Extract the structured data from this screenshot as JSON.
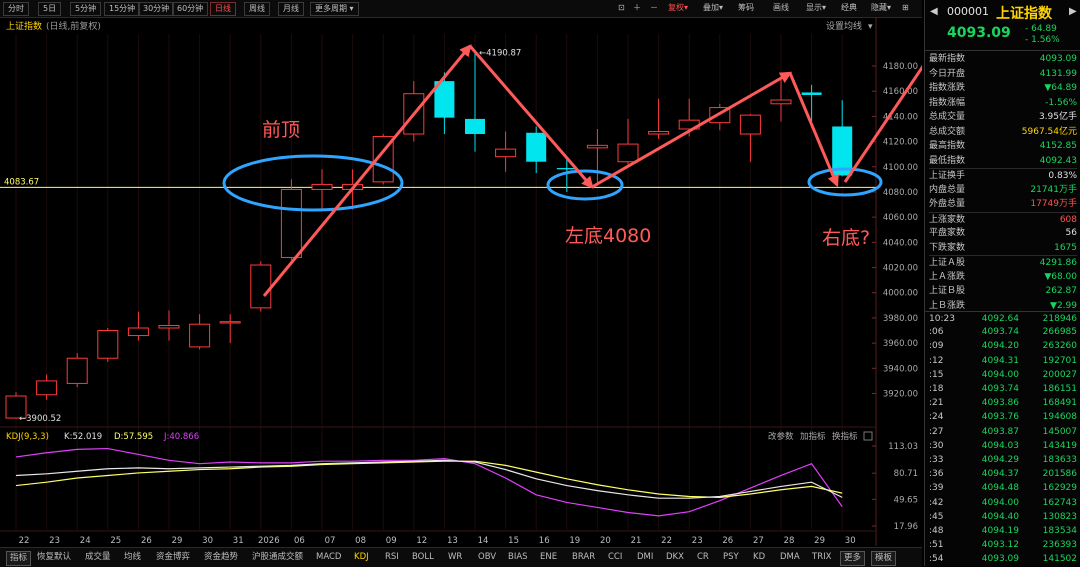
{
  "toolbar": {
    "periods": [
      "分时",
      "5日",
      "5分钟",
      "15分钟",
      "30分钟",
      "60分钟",
      "日线",
      "周线",
      "月线",
      "更多周期"
    ],
    "active_period": "日线",
    "tools": [
      "复权",
      "叠加",
      "筹码",
      "画线",
      "显示",
      "经典",
      "隐藏"
    ]
  },
  "chart_header": {
    "index_name": "上证指数",
    "subtitle": "(日线,前复权)",
    "ma_setting": "设置均线"
  },
  "chart_data": {
    "type": "candlestick",
    "x_labels": [
      "22",
      "23",
      "24",
      "25",
      "26",
      "29",
      "30",
      "31",
      "2026",
      "06",
      "07",
      "08",
      "09",
      "12",
      "13",
      "14",
      "15",
      "16",
      "19",
      "20",
      "21",
      "22",
      "23",
      "26",
      "27",
      "28",
      "29",
      "30"
    ],
    "candles": [
      {
        "o": 3900.52,
        "h": 3921,
        "l": 3900,
        "c": 3918
      },
      {
        "o": 3919,
        "h": 3935,
        "l": 3915,
        "c": 3930
      },
      {
        "o": 3928,
        "h": 3952,
        "l": 3925,
        "c": 3948
      },
      {
        "o": 3948,
        "h": 3972,
        "l": 3945,
        "c": 3970
      },
      {
        "o": 3966,
        "h": 3985,
        "l": 3962,
        "c": 3972
      },
      {
        "o": 3972,
        "h": 3986,
        "l": 3962,
        "c": 3974
      },
      {
        "o": 3957,
        "h": 3983,
        "l": 3955,
        "c": 3975
      },
      {
        "o": 3976,
        "h": 3983,
        "l": 3960,
        "c": 3977
      },
      {
        "o": 3988,
        "h": 4025,
        "l": 3985,
        "c": 4022
      },
      {
        "o": 4028,
        "h": 4090,
        "l": 4026,
        "c": 4082
      },
      {
        "o": 4082,
        "h": 4098,
        "l": 4066,
        "c": 4086
      },
      {
        "o": 4082,
        "h": 4098,
        "l": 4066,
        "c": 4086
      },
      {
        "o": 4088,
        "h": 4126,
        "l": 4086,
        "c": 4124
      },
      {
        "o": 4126,
        "h": 4168,
        "l": 4120,
        "c": 4158
      },
      {
        "o": 4168,
        "h": 4175,
        "l": 4126,
        "c": 4139
      },
      {
        "o": 4138,
        "h": 4190.87,
        "l": 4112,
        "c": 4126
      },
      {
        "o": 4108,
        "h": 4128,
        "l": 4096,
        "c": 4114
      },
      {
        "o": 4127,
        "h": 4132,
        "l": 4095,
        "c": 4104
      },
      {
        "o": 4099,
        "h": 4106,
        "l": 4080,
        "c": 4098
      },
      {
        "o": 4115,
        "h": 4130,
        "l": 4085,
        "c": 4117
      },
      {
        "o": 4104,
        "h": 4138,
        "l": 4102,
        "c": 4118
      },
      {
        "o": 4126,
        "h": 4154,
        "l": 4122,
        "c": 4128
      },
      {
        "o": 4130,
        "h": 4154,
        "l": 4124,
        "c": 4137
      },
      {
        "o": 4135,
        "h": 4150,
        "l": 4129,
        "c": 4147
      },
      {
        "o": 4126,
        "h": 4142,
        "l": 4104,
        "c": 4141
      },
      {
        "o": 4150,
        "h": 4172,
        "l": 4136,
        "c": 4153
      },
      {
        "o": 4159,
        "h": 4165,
        "l": 4136,
        "c": 4157
      },
      {
        "o": 4131.99,
        "h": 4152.85,
        "l": 4092.43,
        "c": 4093.09
      }
    ],
    "high_label": "4190.87",
    "low_label": "3900.52",
    "y_ticks": [
      "4180.00",
      "4160.00",
      "4140.00",
      "4120.00",
      "4100.00",
      "4080.00",
      "4060.00",
      "4040.00",
      "4020.00",
      "4000.00",
      "3980.00",
      "3960.00",
      "3940.00",
      "3920.00"
    ],
    "ylim": [
      3900,
      4200
    ],
    "hline_value": "4083.67",
    "annotations": [
      "前顶",
      "左底4080",
      "右底?"
    ],
    "kdj": {
      "title": "KDJ(9,3,3)",
      "k": "K:52.019",
      "d": "D:57.595",
      "j": "J:40.866",
      "k_values": [
        78,
        80,
        83,
        86,
        87,
        86,
        87,
        88,
        89,
        90,
        92,
        93,
        94,
        95,
        96,
        94,
        85,
        74,
        66,
        60,
        55,
        51,
        51,
        53,
        59,
        65,
        70,
        52
      ],
      "d_values": [
        66,
        70,
        75,
        78,
        81,
        83,
        85,
        86,
        88,
        89,
        91,
        92,
        93,
        94,
        95,
        95,
        90,
        82,
        74,
        67,
        61,
        56,
        53,
        52,
        56,
        61,
        65,
        57
      ],
      "j_values": [
        100,
        105,
        109,
        110,
        103,
        96,
        92,
        94,
        93,
        93,
        95,
        95,
        96,
        96,
        98,
        92,
        75,
        55,
        46,
        40,
        34,
        30,
        35,
        48,
        63,
        78,
        92,
        41
      ],
      "y_ticks": [
        "113.03",
        "80.71",
        "49.65",
        "17.96"
      ],
      "buttons": [
        "改参数",
        "加指标",
        "换指标"
      ]
    }
  },
  "right_panel": {
    "code": "000001",
    "name": "上证指数",
    "price": "4093.09",
    "change": "- 64.89",
    "change_pct": "- 1.56%",
    "stats": [
      {
        "label": "最新指数",
        "value": "4093.09",
        "color": "#19d65f"
      },
      {
        "label": "今日开盘",
        "value": "4131.99",
        "color": "#19d65f"
      },
      {
        "label": "指数涨跌",
        "value": "▼64.89",
        "color": "#19d65f"
      },
      {
        "label": "指数涨幅",
        "value": "-1.56%",
        "color": "#19d65f"
      },
      {
        "label": "总成交量",
        "value": "3.95亿手",
        "color": "#e0e0e0"
      },
      {
        "label": "总成交额",
        "value": "5967.54亿元",
        "color": "#ffd700"
      },
      {
        "label": "最高指数",
        "value": "4152.85",
        "color": "#19d65f"
      },
      {
        "label": "最低指数",
        "value": "4092.43",
        "color": "#19d65f"
      },
      {
        "label": "上证换手",
        "value": "0.83%",
        "color": "#e0e0e0"
      },
      {
        "label": "内盘总量",
        "value": "21741万手",
        "color": "#19d65f"
      },
      {
        "label": "外盘总量",
        "value": "17749万手",
        "color": "#ff5252"
      },
      {
        "label": "上涨家数",
        "value": "608",
        "color": "#ff5252"
      },
      {
        "label": "平盘家数",
        "value": "56",
        "color": "#e0e0e0"
      },
      {
        "label": "下跌家数",
        "value": "1675",
        "color": "#19d65f"
      },
      {
        "label": "上证Ａ股",
        "value": "4291.86",
        "color": "#19d65f"
      },
      {
        "label": "上Ａ涨跌",
        "value": "▼68.00",
        "color": "#19d65f"
      },
      {
        "label": "上证Ｂ股",
        "value": "262.87",
        "color": "#19d65f"
      },
      {
        "label": "上Ｂ涨跌",
        "value": "▼2.99",
        "color": "#19d65f"
      }
    ],
    "ticks": [
      {
        "t": "10:23",
        "p": "4092.64",
        "q": "218946"
      },
      {
        "t": ":06",
        "p": "4093.74",
        "q": "266985"
      },
      {
        "t": ":09",
        "p": "4094.20",
        "q": "263260"
      },
      {
        "t": ":12",
        "p": "4094.31",
        "q": "192701"
      },
      {
        "t": ":15",
        "p": "4094.00",
        "q": "200027"
      },
      {
        "t": ":18",
        "p": "4093.74",
        "q": "186151"
      },
      {
        "t": ":21",
        "p": "4093.86",
        "q": "168491"
      },
      {
        "t": ":24",
        "p": "4093.76",
        "q": "194608"
      },
      {
        "t": ":27",
        "p": "4093.87",
        "q": "145007"
      },
      {
        "t": ":30",
        "p": "4094.03",
        "q": "143419"
      },
      {
        "t": ":33",
        "p": "4094.29",
        "q": "183633"
      },
      {
        "t": ":36",
        "p": "4094.37",
        "q": "201586"
      },
      {
        "t": ":39",
        "p": "4094.48",
        "q": "162929"
      },
      {
        "t": ":42",
        "p": "4094.00",
        "q": "162743"
      },
      {
        "t": ":45",
        "p": "4094.40",
        "q": "130823"
      },
      {
        "t": ":48",
        "p": "4094.19",
        "q": "183534"
      },
      {
        "t": ":51",
        "p": "4093.12",
        "q": "236393"
      },
      {
        "t": ":54",
        "p": "4093.09",
        "q": "141502"
      }
    ]
  },
  "bottom_tabs": [
    "指标",
    "恢复默认",
    "成交量",
    "均线",
    "资金博弈",
    "资金趋势",
    "沪股通成交额",
    "MACD",
    "KDJ",
    "RSI",
    "BOLL",
    "WR",
    "OBV",
    "BIAS",
    "ENE",
    "BRAR",
    "CCI",
    "DMI",
    "DKX",
    "CR",
    "PSY",
    "KD",
    "DMA",
    "TRIX",
    "更多",
    "模板"
  ],
  "active_tab": "KDJ"
}
